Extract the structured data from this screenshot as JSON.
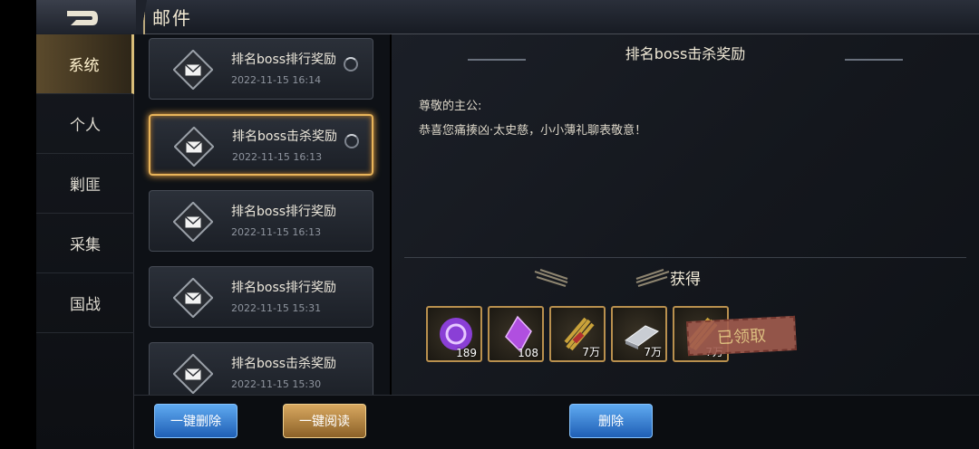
{
  "header": {
    "title": "邮件",
    "back_icon": "back-arrow-icon"
  },
  "tabs": [
    {
      "label": "系统",
      "active": true
    },
    {
      "label": "个人",
      "active": false
    },
    {
      "label": "剿匪",
      "active": false
    },
    {
      "label": "采集",
      "active": false
    },
    {
      "label": "国战",
      "active": false
    }
  ],
  "mails": [
    {
      "title": "排名boss排行奖励",
      "time": "2022-11-15   16:14",
      "selected": false
    },
    {
      "title": "排名boss击杀奖励",
      "time": "2022-11-15   16:13",
      "selected": true
    },
    {
      "title": "排名boss排行奖励",
      "time": "2022-11-15   16:13",
      "selected": false
    },
    {
      "title": "排名boss排行奖励",
      "time": "2022-11-15   15:31",
      "selected": false
    },
    {
      "title": "排名boss击杀奖励",
      "time": "2022-11-15   15:30",
      "selected": false
    }
  ],
  "detail": {
    "title": "排名boss击杀奖励",
    "greeting": "尊敬的主公:",
    "body": "恭喜您痛揍凶·太史慈，小小薄礼聊表敬意！",
    "obtain_label": "获得",
    "claimed_stamp": "已领取",
    "items": [
      {
        "icon": "purple-orb-icon",
        "qty": "189",
        "color": "#8a3fd6"
      },
      {
        "icon": "purple-crystal-icon",
        "qty": "108",
        "color": "#b04fe0"
      },
      {
        "icon": "grain-bundle-icon",
        "qty": "7万",
        "color": "#c9a23a"
      },
      {
        "icon": "silver-ingot-icon",
        "qty": "7万",
        "color": "#c9cdd3"
      },
      {
        "icon": "grain-bundle-icon",
        "qty": "7万",
        "color": "#c9a23a"
      }
    ]
  },
  "buttons": {
    "delete_all": "一键删除",
    "read_all": "一键阅读",
    "delete": "删除"
  }
}
